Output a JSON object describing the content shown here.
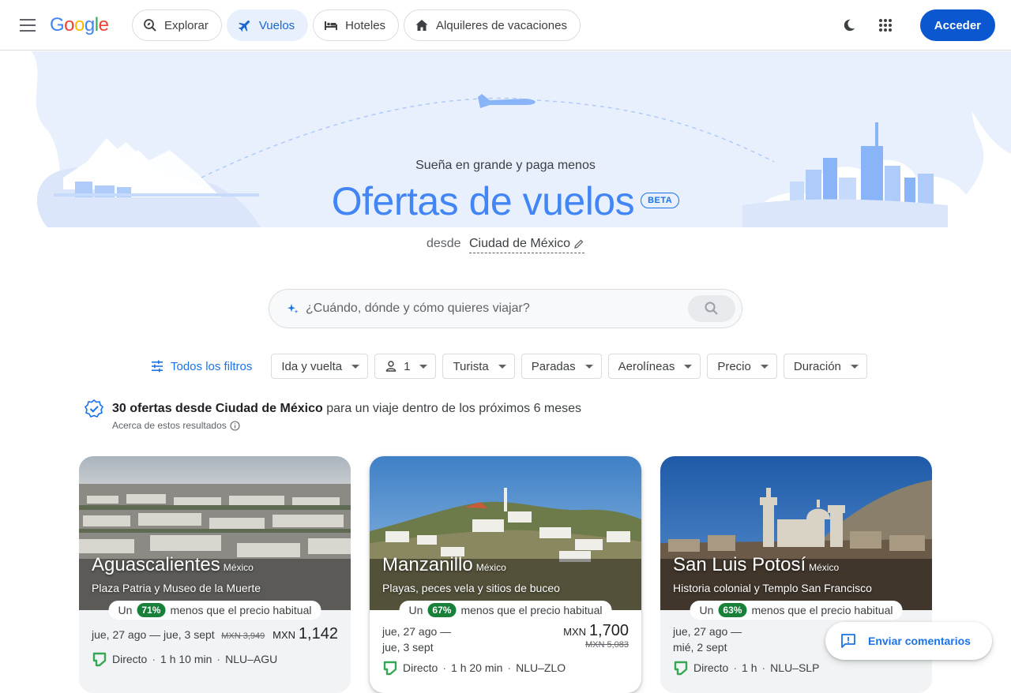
{
  "header": {
    "logo": "Google",
    "nav": [
      {
        "label": "Explorar",
        "icon": "explore-icon"
      },
      {
        "label": "Vuelos",
        "icon": "plane-icon"
      },
      {
        "label": "Hoteles",
        "icon": "bed-icon"
      },
      {
        "label": "Alquileres de vacaciones",
        "icon": "house-icon"
      }
    ],
    "signin_label": "Acceder"
  },
  "hero": {
    "subtitle": "Sueña en grande y paga menos",
    "title": "Ofertas de vuelos",
    "badge": "BETA",
    "from_label": "desde",
    "from_city": "Ciudad de México"
  },
  "search": {
    "placeholder": "¿Cuándo, dónde y cómo quieres viajar?"
  },
  "filters": {
    "all_label": "Todos los filtros",
    "chips": [
      "Ida y vuelta",
      "1",
      "Turista",
      "Paradas",
      "Aerolíneas",
      "Precio",
      "Duración"
    ]
  },
  "results": {
    "count_bold": "30 ofertas desde Ciudad de México",
    "count_rest": "para un viaje dentro de los próximos 6 meses",
    "about": "Acerca de estos resultados"
  },
  "cards": [
    {
      "name": "Aguascalientes",
      "country": "México",
      "desc": "Plaza Patria y Museo de la Muerte",
      "deal_pre": "Un",
      "deal_pct": "71%",
      "deal_post": "menos que el precio habitual",
      "dates": "jue, 27 ago — jue, 3 sept",
      "old_price": "MXN 3,949",
      "currency": "MXN",
      "price": "1,142",
      "stops": "Directo",
      "duration": "1 h 10 min",
      "route": "NLU–AGU"
    },
    {
      "name": "Manzanillo",
      "country": "México",
      "desc": "Playas, peces vela y sitios de buceo",
      "deal_pre": "Un",
      "deal_pct": "67%",
      "deal_post": "menos que el precio habitual",
      "dates_1": "jue, 27 ago —",
      "dates_2": "jue, 3 sept",
      "old_price": "MXN 5,083",
      "currency": "MXN",
      "price": "1,700",
      "stops": "Directo",
      "duration": "1 h 20 min",
      "route": "NLU–ZLO"
    },
    {
      "name": "San Luis Potosí",
      "country": "México",
      "desc": "Historia colonial y Templo San Francisco",
      "deal_pre": "Un",
      "deal_pct": "63%",
      "deal_post": "menos que el precio habitual",
      "dates_1": "jue, 27 ago —",
      "dates_2": "mié, 2 sept",
      "stops": "Directo",
      "duration": "1 h",
      "route": "NLU–SLP"
    }
  ],
  "feedback": {
    "label": "Enviar comentarios"
  },
  "colors": {
    "accent": "#1a73e8",
    "signin": "#0b57d0",
    "deal": "#188038",
    "hero_title": "#4285f4"
  }
}
